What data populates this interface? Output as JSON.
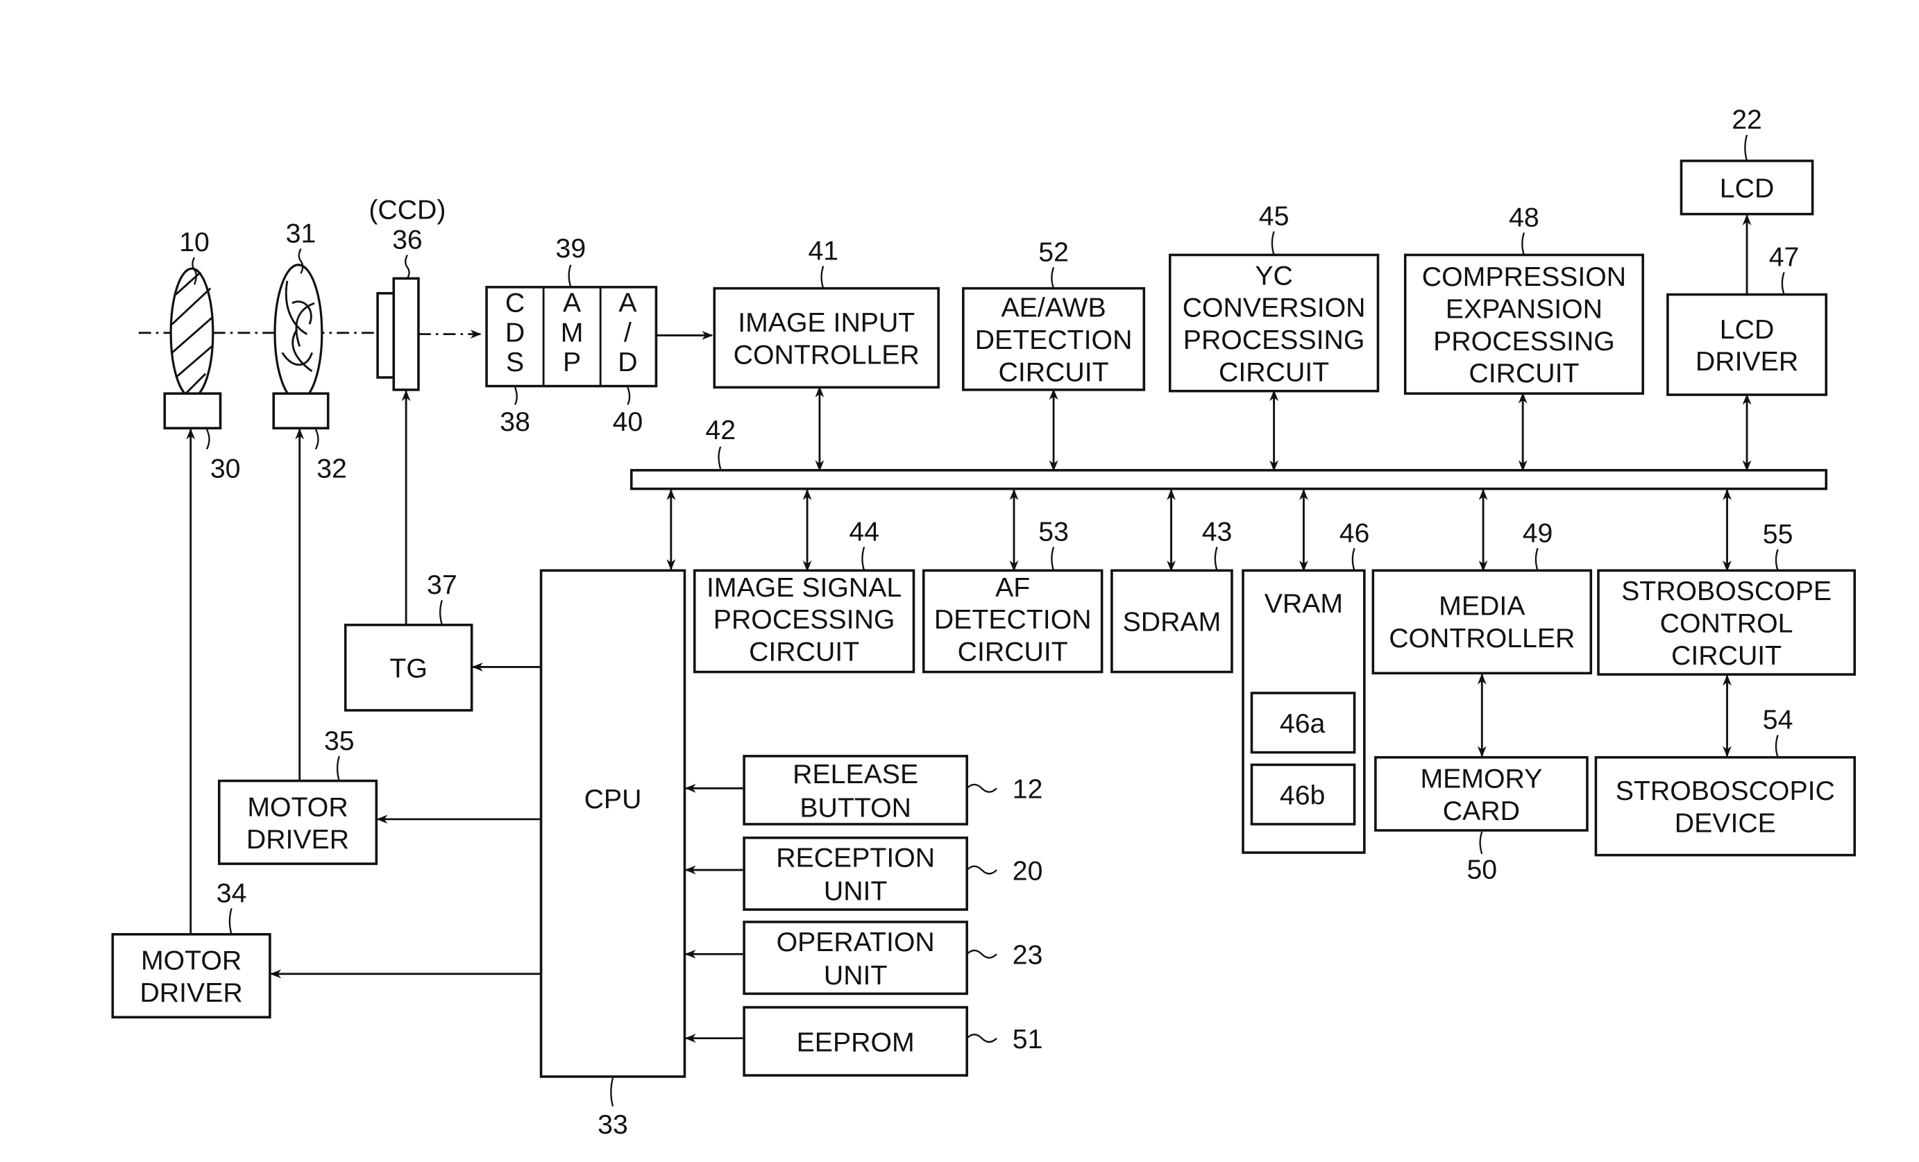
{
  "figure": {
    "type": "block-diagram",
    "subject": "Digital camera internal configuration"
  },
  "optics": {
    "lens": {
      "ref": "10"
    },
    "lens_motor": {
      "ref": "30"
    },
    "aperture": {
      "ref": "31"
    },
    "aperture_motor": {
      "ref": "32"
    },
    "ccd": {
      "ref": "36",
      "caption": "(CCD)"
    }
  },
  "analog_chain": {
    "ref": "39",
    "cells": [
      {
        "ref": "38",
        "lines": [
          "C",
          "D",
          "S"
        ]
      },
      {
        "ref": "",
        "lines": [
          "A",
          "M",
          "P"
        ]
      },
      {
        "ref": "40",
        "lines": [
          "A",
          "/",
          "D"
        ]
      }
    ]
  },
  "bus": {
    "ref": "42"
  },
  "top_blocks": [
    {
      "id": "image-input-controller",
      "ref": "41",
      "lines": [
        "IMAGE INPUT",
        "CONTROLLER"
      ]
    },
    {
      "id": "ae-awb-detection-circuit",
      "ref": "52",
      "lines": [
        "AE/AWB",
        "DETECTION",
        "CIRCUIT"
      ]
    },
    {
      "id": "yc-conversion-processing-circuit",
      "ref": "45",
      "lines": [
        "YC",
        "CONVERSION",
        "PROCESSING",
        "CIRCUIT"
      ]
    },
    {
      "id": "compression-expansion-processing-circuit",
      "ref": "48",
      "lines": [
        "COMPRESSION",
        "EXPANSION",
        "PROCESSING",
        "CIRCUIT"
      ]
    },
    {
      "id": "lcd-driver",
      "ref": "47",
      "lines": [
        "LCD",
        "DRIVER"
      ]
    }
  ],
  "lcd": {
    "ref": "22",
    "lines": [
      "LCD"
    ]
  },
  "bottom_blocks": [
    {
      "id": "image-signal-processing-circuit",
      "ref": "44",
      "lines": [
        "IMAGE SIGNAL",
        "PROCESSING",
        "CIRCUIT"
      ]
    },
    {
      "id": "af-detection-circuit",
      "ref": "53",
      "lines": [
        "AF",
        "DETECTION",
        "CIRCUIT"
      ]
    },
    {
      "id": "sdram",
      "ref": "43",
      "lines": [
        "SDRAM"
      ]
    },
    {
      "id": "vram",
      "ref": "46",
      "lines": [
        "VRAM"
      ],
      "sub": [
        {
          "ref": "46a"
        },
        {
          "ref": "46b"
        }
      ]
    },
    {
      "id": "media-controller",
      "ref": "49",
      "lines": [
        "MEDIA",
        "CONTROLLER"
      ]
    },
    {
      "id": "stroboscope-control-circuit",
      "ref": "55",
      "lines": [
        "STROBOSCOPE",
        "CONTROL",
        "CIRCUIT"
      ]
    }
  ],
  "memory_card": {
    "ref": "50",
    "lines": [
      "MEMORY",
      "CARD"
    ]
  },
  "stroboscopic_device": {
    "ref": "54",
    "lines": [
      "STROBOSCOPIC",
      "DEVICE"
    ]
  },
  "cpu": {
    "ref": "33",
    "lines": [
      "CPU"
    ]
  },
  "tg": {
    "ref": "37",
    "lines": [
      "TG"
    ]
  },
  "motor_driver_35": {
    "ref": "35",
    "lines": [
      "MOTOR",
      "DRIVER"
    ]
  },
  "motor_driver_34": {
    "ref": "34",
    "lines": [
      "MOTOR",
      "DRIVER"
    ]
  },
  "inputs": [
    {
      "id": "release-button",
      "ref": "12",
      "lines": [
        "RELEASE",
        "BUTTON"
      ]
    },
    {
      "id": "reception-unit",
      "ref": "20",
      "lines": [
        "RECEPTION",
        "UNIT"
      ]
    },
    {
      "id": "operation-unit",
      "ref": "23",
      "lines": [
        "OPERATION",
        "UNIT"
      ]
    },
    {
      "id": "eeprom",
      "ref": "51",
      "lines": [
        "EEPROM"
      ]
    }
  ]
}
